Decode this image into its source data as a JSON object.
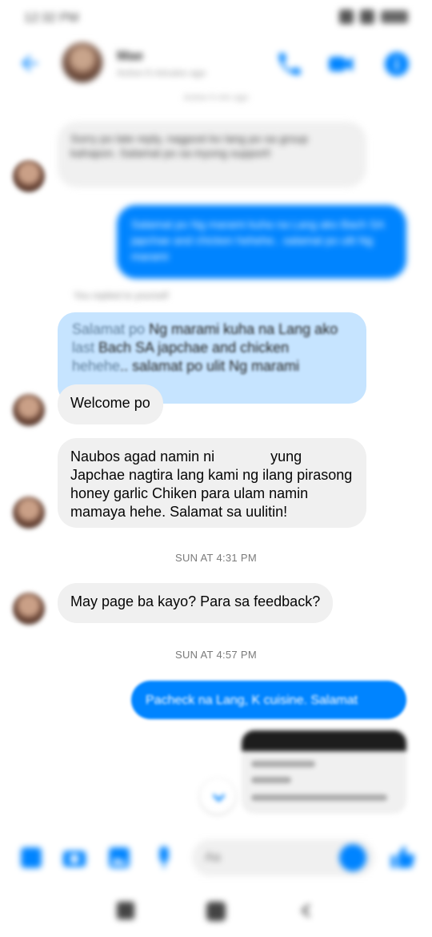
{
  "status_bar": {
    "time": "12:32 PM",
    "battery": "100"
  },
  "header": {
    "contact_name": "Mae",
    "contact_status": "Active 6 minutes ago",
    "subtitle": "Active 6 min ago",
    "accent": "#0084ff"
  },
  "messages": {
    "m1": {
      "text": "Sorry po late reply, nagpost ko lang po sa group kahapon. Salamat po sa inyong support!"
    },
    "m2": {
      "text": "Salamat po Ng marami kuha na Lang ako Bach SA japchae and chicken hehehe.. salamat po ulit Ng marami"
    },
    "replied_label": "You replied to yourself",
    "m3": {
      "q_faded1": "Salamat po",
      "q_line1": " Ng marami kuha na Lang ako",
      "q_faded2": "last",
      "q_line2": " Bach SA japchae and chicken",
      "q_faded3": "hehehe",
      "q_line3": ".. salamat po ulit Ng marami"
    },
    "m4": {
      "text": "Welcome po"
    },
    "m5": {
      "part1": "Naubos agad namin ni",
      "part2": "yung Japchae nagtira lang kami ng ilang pirasong honey garlic Chiken para ulam namin mamaya hehe. Salamat sa uulitin!"
    },
    "time1": "SUN AT 4:31 PM",
    "m6": {
      "text": "May page ba kayo? Para sa feedback?"
    },
    "time2": "SUN AT 4:57 PM",
    "m7": {
      "text": "Pacheck na Lang, K cuisine. Salamat"
    }
  },
  "composer": {
    "placeholder": "Aa"
  },
  "icons": {
    "back": "arrow-left-icon",
    "call": "phone-icon",
    "video": "video-camera-icon",
    "info": "info-icon",
    "menu": "grid-menu-icon",
    "camera": "camera-icon",
    "gallery": "gallery-icon",
    "mic": "microphone-icon",
    "emoji": "emoji-icon",
    "like": "thumbs-up-icon"
  }
}
